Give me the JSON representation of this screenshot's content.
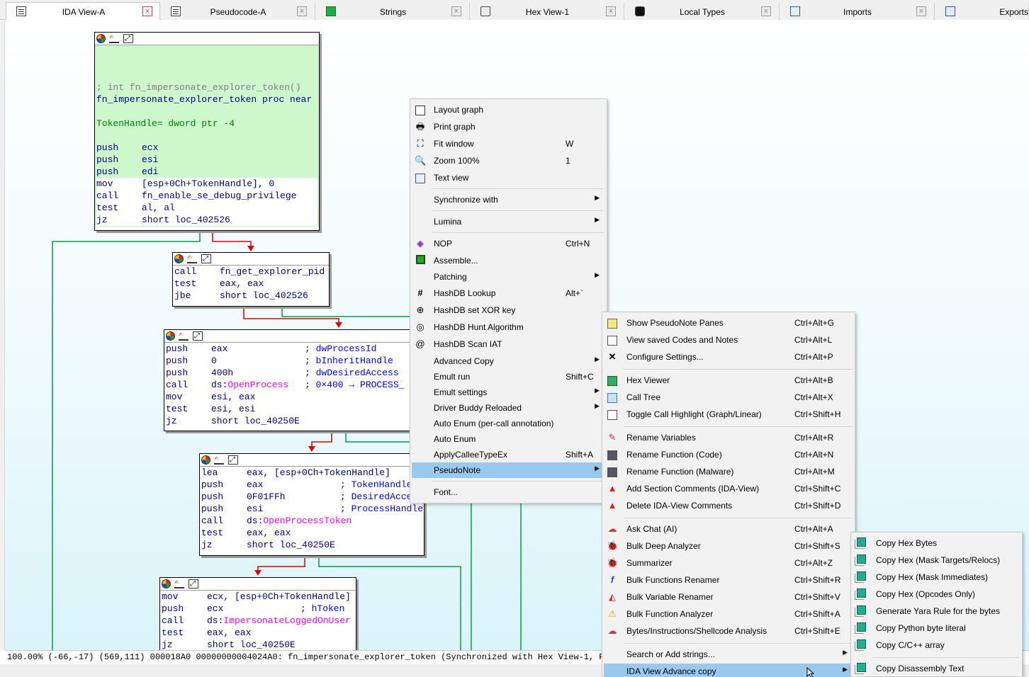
{
  "tabs": [
    {
      "label": "IDA View-A",
      "icon": "grid-icon",
      "active": true
    },
    {
      "label": "Pseudocode-A",
      "icon": "grid-icon"
    },
    {
      "label": "Strings",
      "icon": "strings-icon"
    },
    {
      "label": "Hex View-1",
      "icon": "hex-icon"
    },
    {
      "label": "Local Types",
      "icon": "local-types-icon"
    },
    {
      "label": "Imports",
      "icon": "imports-icon"
    },
    {
      "label": "Exports",
      "icon": "exports-icon"
    }
  ],
  "tab_close_glyph": "×",
  "nodes": {
    "n1": {
      "lines": [
        {
          "t": "",
          "cls": "blank"
        },
        {
          "t": "",
          "cls": "blank"
        },
        {
          "t": "",
          "cls": "blank"
        },
        {
          "t": "; int fn_impersonate_explorer_token()",
          "cls": "comment"
        },
        {
          "t": "fn_impersonate_explorer_token proc near",
          "cls": ""
        },
        {
          "t": "",
          "cls": "blank"
        },
        {
          "t": "TokenHandle= dword ptr -4",
          "cls": "green"
        },
        {
          "t": "",
          "cls": "blank"
        },
        {
          "m": "push",
          "o": "ecx"
        },
        {
          "m": "push",
          "o": "esi"
        },
        {
          "m": "push",
          "o": "edi"
        },
        {
          "m": "mov",
          "o": "[esp+0Ch+TokenHandle], 0",
          "cls": "hl"
        },
        {
          "m": "call",
          "o": "fn_enable_se_debug_privilege",
          "cls": "hl"
        },
        {
          "m": "test",
          "o": "al, al",
          "cls": "hl"
        },
        {
          "m": "jz",
          "o": "short loc_402526",
          "cls": "hl"
        }
      ]
    },
    "n2": {
      "lines": [
        {
          "m": "call",
          "o": "fn_get_explorer_pid"
        },
        {
          "m": "test",
          "o": "eax, eax"
        },
        {
          "m": "jbe",
          "o": "short loc_402526"
        }
      ]
    },
    "n3": {
      "lines": [
        {
          "m": "push",
          "o": "eax",
          "c": "; dwProcessId"
        },
        {
          "m": "push",
          "o": "0",
          "c": "; bInheritHandle"
        },
        {
          "m": "push",
          "o": "400h",
          "c": "; dwDesiredAccess"
        },
        {
          "m": "call",
          "o": "ds:",
          "i": "OpenProcess",
          "c": "; 0×400 → PROCESS_"
        },
        {
          "m": "mov",
          "o": "esi, eax"
        },
        {
          "m": "test",
          "o": "esi, esi"
        },
        {
          "m": "jz",
          "o": "short loc_40250E"
        }
      ]
    },
    "n4": {
      "lines": [
        {
          "m": "lea",
          "o": "eax, [esp+0Ch+TokenHandle]"
        },
        {
          "m": "push",
          "o": "eax",
          "c": "; TokenHandle"
        },
        {
          "m": "push",
          "o": "0F01FFh",
          "c": "; DesiredAccess"
        },
        {
          "m": "push",
          "o": "esi",
          "c": "; ProcessHandle"
        },
        {
          "m": "call",
          "o": "ds:",
          "i": "OpenProcessToken"
        },
        {
          "m": "test",
          "o": "eax, eax"
        },
        {
          "m": "jz",
          "o": "short loc_40250E"
        }
      ]
    },
    "n5": {
      "lines": [
        {
          "m": "mov",
          "o": "ecx, [esp+0Ch+TokenHandle]"
        },
        {
          "m": "push",
          "o": "ecx",
          "c": "; hToken"
        },
        {
          "m": "call",
          "o": "ds:",
          "i": "ImpersonateLoggedOnUser"
        },
        {
          "m": "test",
          "o": "eax, eax"
        },
        {
          "m": "jz",
          "o": "short loc_40250E"
        }
      ]
    }
  },
  "status": "100.00% (-66,-17) (569,111) 000018A0 00000000004024A0: fn_impersonate_explorer_token (Synchronized with Hex View-1, Pseudocode-A)",
  "menu1": [
    {
      "label": "Layout graph",
      "icon": "layout-graph-icon"
    },
    {
      "label": "Print graph",
      "icon": "printer-icon"
    },
    {
      "label": "Fit window",
      "icon": "fit-window-icon",
      "shortcut": "W"
    },
    {
      "label": "Zoom 100%",
      "icon": "zoom-icon",
      "shortcut": "1"
    },
    {
      "label": "Text view",
      "icon": "text-view-icon"
    },
    {
      "sep": true
    },
    {
      "label": "Synchronize with",
      "submenu": true
    },
    {
      "sep": true
    },
    {
      "label": "Lumina",
      "submenu": true
    },
    {
      "sep": true
    },
    {
      "label": "NOP",
      "icon": "eraser-icon",
      "shortcut": "Ctrl+N"
    },
    {
      "label": "Assemble...",
      "icon": "chip-icon"
    },
    {
      "label": "Patching",
      "submenu": true
    },
    {
      "label": "HashDB Lookup",
      "icon": "hash-icon",
      "shortcut": "Alt+`"
    },
    {
      "label": "HashDB set XOR key",
      "icon": "xor-icon"
    },
    {
      "label": "HashDB Hunt Algorithm",
      "icon": "target-icon"
    },
    {
      "label": "HashDB Scan IAT",
      "icon": "spiral-icon"
    },
    {
      "label": "Advanced Copy",
      "submenu": true
    },
    {
      "label": "Emult run",
      "shortcut": "Shift+C"
    },
    {
      "label": "Emult settings",
      "submenu": true
    },
    {
      "label": "Driver Buddy Reloaded",
      "submenu": true
    },
    {
      "label": "Auto Enum (per-call annotation)"
    },
    {
      "label": "Auto Enum"
    },
    {
      "label": "ApplyCalleeTypeEx",
      "shortcut": "Shift+A"
    },
    {
      "label": "PseudoNote",
      "submenu": true,
      "selected": true
    },
    {
      "sep": true
    },
    {
      "label": "Font..."
    }
  ],
  "menu2": [
    {
      "label": "Show PseudoNote Panes",
      "icon": "notepad-icon",
      "shortcut": "Ctrl+Alt+G"
    },
    {
      "label": "View saved Codes and Notes",
      "icon": "notes-icon",
      "shortcut": "Ctrl+Alt+L"
    },
    {
      "label": "Configure Settings...",
      "icon": "settings-x-icon",
      "shortcut": "Ctrl+Alt+P"
    },
    {
      "sep": true
    },
    {
      "label": "Hex Viewer",
      "icon": "hex-viewer-icon",
      "shortcut": "Ctrl+Alt+B"
    },
    {
      "label": "Call Tree",
      "icon": "call-tree-icon",
      "shortcut": "Ctrl+Alt+X"
    },
    {
      "label": "Toggle Call Highlight (Graph/Linear)",
      "icon": "highlight-icon",
      "shortcut": "Ctrl+Shift+H"
    },
    {
      "sep": true
    },
    {
      "label": "Rename Variables",
      "icon": "rename-variables-icon",
      "shortcut": "Ctrl+Alt+R"
    },
    {
      "label": "Rename Function (Code)",
      "icon": "rename-function-icon",
      "shortcut": "Ctrl+Alt+N"
    },
    {
      "label": "Rename Function (Malware)",
      "icon": "rename-malware-icon",
      "shortcut": "Ctrl+Alt+M"
    },
    {
      "label": "Add Section Comments (IDA-View)",
      "icon": "warning-icon",
      "shortcut": "Ctrl+Shift+C"
    },
    {
      "label": "Delete IDA-View Comments",
      "icon": "warning-icon",
      "shortcut": "Ctrl+Shift+D"
    },
    {
      "sep": true
    },
    {
      "label": "Ask Chat (AI)",
      "icon": "chat-icon",
      "shortcut": "Ctrl+Alt+A"
    },
    {
      "label": "Bulk Deep Analyzer",
      "icon": "bug-icon",
      "shortcut": "Ctrl+Shift+S"
    },
    {
      "label": "Summarizer",
      "icon": "bug-icon",
      "shortcut": "Ctrl+Alt+Z"
    },
    {
      "label": "Bulk Functions Renamer",
      "icon": "function-icon",
      "shortcut": "Ctrl+Shift+R"
    },
    {
      "label": "Bulk Variable Renamer",
      "icon": "shapes-icon",
      "shortcut": "Ctrl+Shift+V"
    },
    {
      "label": "Bulk Function Analyzer",
      "icon": "caution-icon",
      "shortcut": "Ctrl+Shift+A"
    },
    {
      "label": "Bytes/Instructions/Shellcode Analysis",
      "icon": "chat-icon",
      "shortcut": "Ctrl+Shift+E"
    },
    {
      "sep": true
    },
    {
      "label": "Search or Add strings...",
      "submenu": true
    },
    {
      "label": "IDA View Advance copy",
      "submenu": true,
      "selected": true
    }
  ],
  "menu3": [
    {
      "label": "Copy Hex Bytes",
      "icon": "copy-icon"
    },
    {
      "label": "Copy Hex (Mask Targets/Relocs)",
      "icon": "copy-icon"
    },
    {
      "label": "Copy Hex (Mask Immediates)",
      "icon": "copy-icon"
    },
    {
      "label": "Copy Hex (Opcodes Only)",
      "icon": "copy-icon"
    },
    {
      "label": "Generate Yara Rule for the bytes",
      "icon": "copy-icon"
    },
    {
      "label": "Copy Python byte literal",
      "icon": "copy-icon"
    },
    {
      "label": "Copy C/C++ array",
      "icon": "copy-icon"
    },
    {
      "sep": true
    },
    {
      "label": "Copy Disassembly Text",
      "icon": "copy-icon"
    }
  ],
  "submenu_arrow": "▶"
}
